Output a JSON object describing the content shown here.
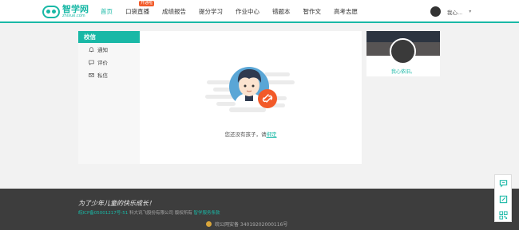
{
  "header": {
    "logo": {
      "name_cn": "智学网",
      "name_en": "zhixue.com"
    },
    "nav": [
      {
        "label": "首页",
        "active": true,
        "badge": ""
      },
      {
        "label": "口袋直播",
        "active": false,
        "badge": "开通啦"
      },
      {
        "label": "成绩报告",
        "active": false,
        "badge": ""
      },
      {
        "label": "提分学习",
        "active": false,
        "badge": ""
      },
      {
        "label": "作业中心",
        "active": false,
        "badge": ""
      },
      {
        "label": "错题本",
        "active": false,
        "badge": ""
      },
      {
        "label": "智作文",
        "active": false,
        "badge": ""
      },
      {
        "label": "高考志愿",
        "active": false,
        "badge": ""
      }
    ],
    "user": {
      "name": "我心...",
      "caret_icon": "caret-down-icon"
    }
  },
  "sidebar": {
    "title": "校信",
    "items": [
      {
        "label": "通知",
        "icon": "bell-icon"
      },
      {
        "label": "评价",
        "icon": "comment-icon"
      },
      {
        "label": "私信",
        "icon": "mail-icon"
      }
    ]
  },
  "main": {
    "empty_text": "您还没有孩子，请",
    "empty_link": "绑定"
  },
  "profile": {
    "name": "我心依旧。"
  },
  "footer": {
    "slogan": "为了少年儿童的快乐成长！",
    "icp": "皖ICP备05001217号-51",
    "company": "科大讯飞股份有限公司 版权所有",
    "service_link": "智学服务条款",
    "police": "皖公网安备 34019202000116号"
  },
  "colors": {
    "accent": "#19b8a6",
    "badge": "#f25a29",
    "footer_bg": "#3d3d3d"
  },
  "float_tools": [
    "chat-icon",
    "edit-icon",
    "qrcode-icon"
  ]
}
